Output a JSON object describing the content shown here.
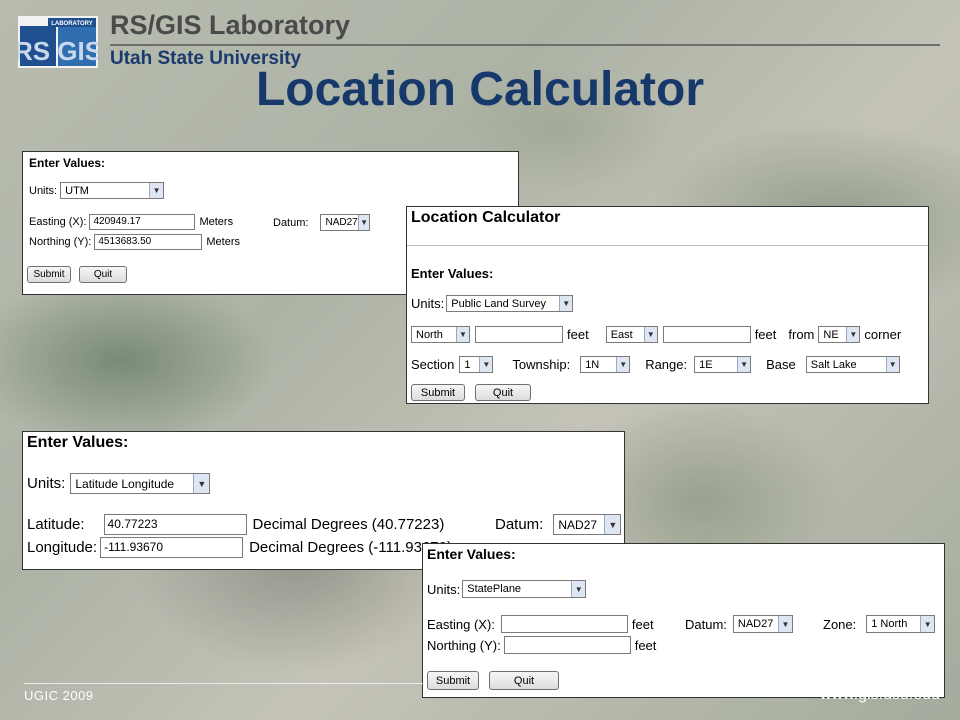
{
  "header": {
    "lab_name": "RS/GIS Laboratory",
    "university": "Utah State University",
    "logo_badge": "LABORATORY",
    "logo_letters": "RS GIS"
  },
  "title": "Location Calculator",
  "footer": {
    "left": "UGIC 2009",
    "right": "www.gis.usu.edu"
  },
  "panel_utm": {
    "heading": "Enter Values:",
    "units_label": "Units:",
    "units_value": "UTM",
    "easting_label": "Easting (X):",
    "easting_value": "420949.17",
    "easting_unit": "Meters",
    "northing_label": "Northing (Y):",
    "northing_value": "4513683.50",
    "northing_unit": "Meters",
    "datum_label": "Datum:",
    "datum_value": "NAD27",
    "submit": "Submit",
    "quit": "Quit"
  },
  "panel_pls": {
    "title": "Location Calculator",
    "heading": "Enter Values:",
    "units_label": "Units:",
    "units_value": "Public Land Survey",
    "dir1": "North",
    "feet1": "feet",
    "dir2": "East",
    "feet2": "feet",
    "from_label": "from",
    "corner_value": "NE",
    "corner_label": "corner",
    "section_label": "Section",
    "section_value": "1",
    "township_label": "Township:",
    "township_value": "1N",
    "range_label": "Range:",
    "range_value": "1E",
    "base_label": "Base",
    "base_value": "Salt Lake",
    "submit": "Submit",
    "quit": "Quit"
  },
  "panel_latlon": {
    "heading": "Enter Values:",
    "units_label": "Units:",
    "units_value": "Latitude Longitude",
    "lat_label": "Latitude:",
    "lat_value": "40.77223",
    "lat_desc": "Decimal Degrees (40.77223)",
    "lon_label": "Longitude:",
    "lon_value": "-111.93670",
    "lon_desc": "Decimal Degrees (-111.93670)",
    "datum_label": "Datum:",
    "datum_value": "NAD27"
  },
  "panel_sp": {
    "heading": "Enter Values:",
    "units_label": "Units:",
    "units_value": "StatePlane",
    "easting_label": "Easting (X):",
    "easting_unit": "feet",
    "northing_label": "Northing (Y):",
    "northing_unit": "feet",
    "datum_label": "Datum:",
    "datum_value": "NAD27",
    "zone_label": "Zone:",
    "zone_value": "1 North",
    "submit": "Submit",
    "quit": "Quit"
  },
  "icons": {
    "dropdown": "chevron-down-icon"
  }
}
